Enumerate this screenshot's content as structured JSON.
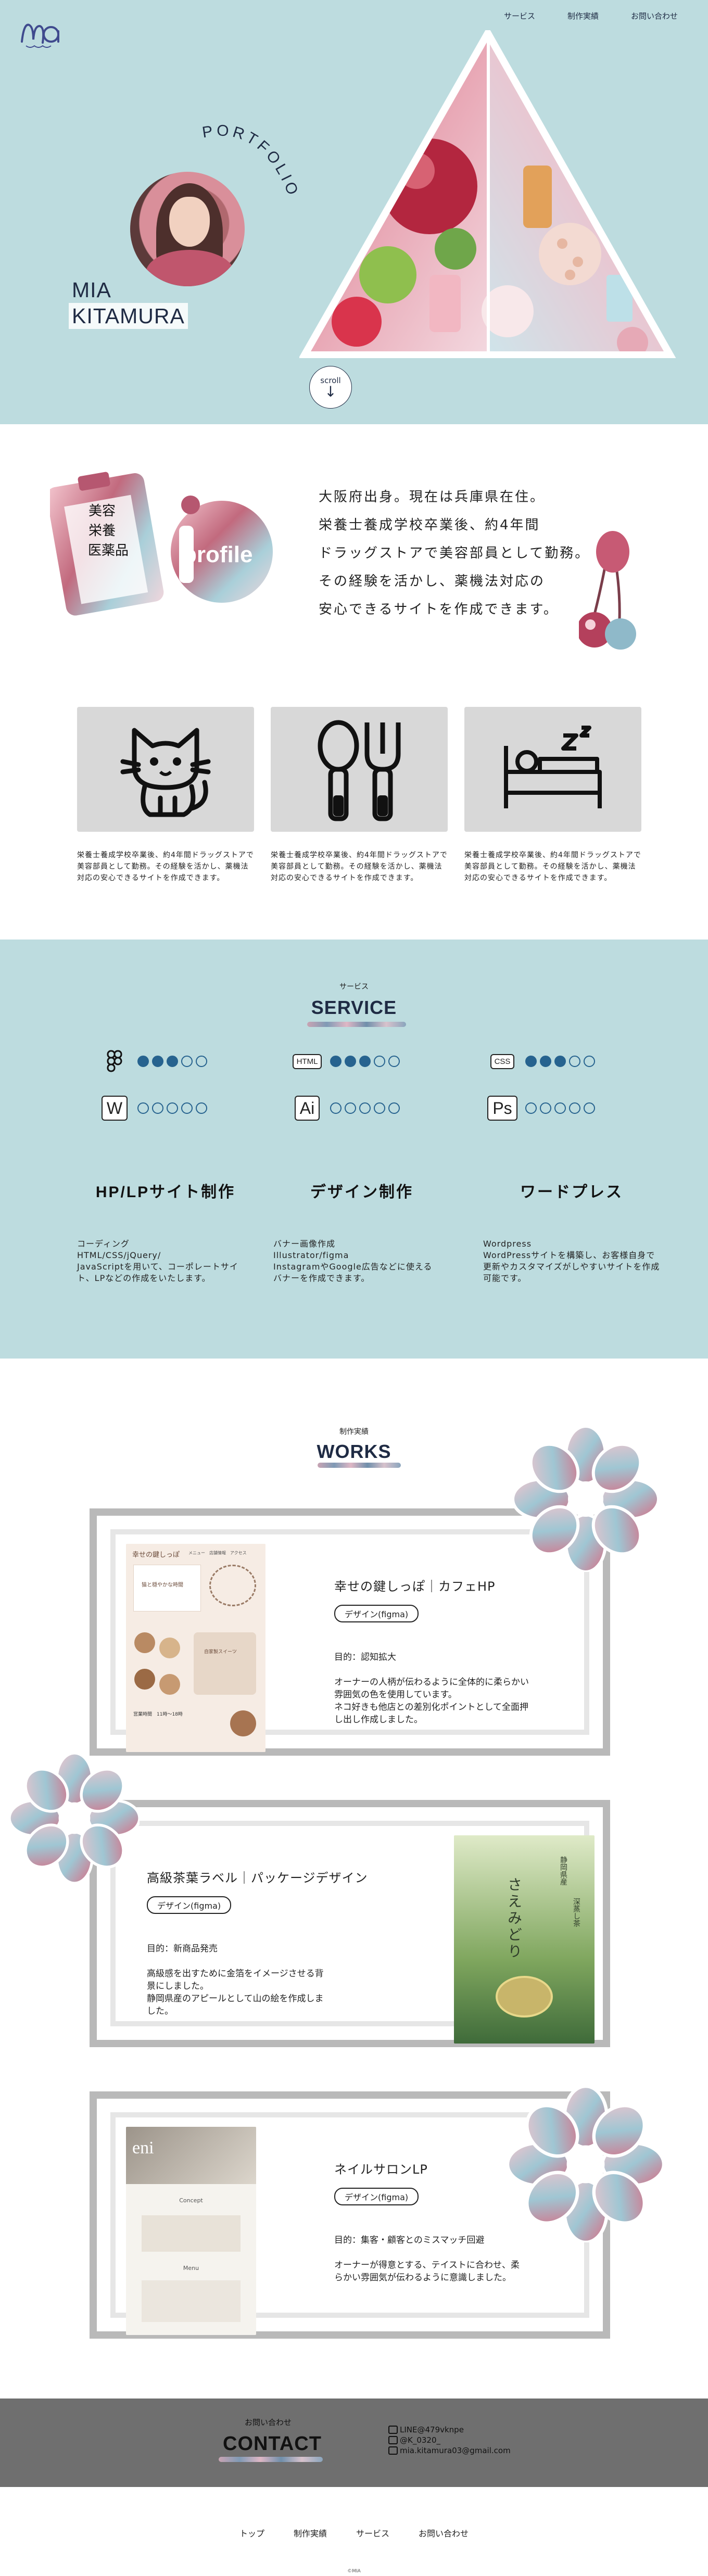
{
  "nav": {
    "items": [
      "サービス",
      "制作実績",
      "お問い合わせ"
    ]
  },
  "hero": {
    "portfolio_label": "PORTFOLIO",
    "name_line1": "MIA",
    "name_line2": "KITAMURA",
    "scroll_label": "scroll",
    "scroll_arrow": "↓"
  },
  "profile": {
    "art_words": [
      "美容",
      "栄養",
      "医薬品"
    ],
    "art_label": "profile",
    "text_lines": [
      "大阪府出身。現在は兵庫県在住。",
      "栄養士養成学校卒業後、約4年間",
      "ドラッグストアで美容部員として勤務。",
      "その経験を活かし、薬機法対応の",
      "安心できるサイトを作成できます。"
    ],
    "features": [
      {
        "icon": "cat-icon",
        "desc": "栄養士養成学校卒業後、約4年間ドラッグストアで美容部員として勤務。その経験を活かし、薬機法対応の安心できるサイトを作成できます。"
      },
      {
        "icon": "spoon-fork-icon",
        "desc": "栄養士養成学校卒業後、約4年間ドラッグストアで美容部員として勤務。その経験を活かし、薬機法対応の安心できるサイトを作成できます。"
      },
      {
        "icon": "sleep-icon",
        "desc": "栄養士養成学校卒業後、約4年間ドラッグストアで美容部員として勤務。その経験を活かし、薬機法対応の安心できるサイトを作成できます。"
      }
    ]
  },
  "service": {
    "subtitle": "サービス",
    "title": "SERVICE",
    "skills": [
      {
        "icon": "figma-icon",
        "label": "",
        "level": 3
      },
      {
        "icon": "html-icon",
        "label": "HTML",
        "level": 3
      },
      {
        "icon": "css-icon",
        "label": "CSS",
        "level": 3
      },
      {
        "icon": "word-icon",
        "label": "W",
        "level": 0
      },
      {
        "icon": "illustrator-icon",
        "label": "Ai",
        "level": 0
      },
      {
        "icon": "photoshop-icon",
        "label": "Ps",
        "level": 0
      }
    ],
    "columns": [
      {
        "title": "HP/LPサイト制作",
        "desc": "コーディング\nHTML/CSS/jQuery/\nJavaScriptを用いて、コーポレートサイト、LPなどの作成をいたします。"
      },
      {
        "title": "デザイン制作",
        "desc": "バナー画像作成\nIllustrator/figma\nInstagramやGoogle広告などに使える\nバナーを作成できます。"
      },
      {
        "title": "ワードプレス",
        "desc": "Wordpress\nWordPressサイトを構築し、お客様自身で更新やカスタマイズがしやすいサイトを作成可能です。"
      }
    ]
  },
  "works": {
    "subtitle": "制作実績",
    "title": "WORKS",
    "items": [
      {
        "title": "幸せの鍵しっぽ｜カフェHP",
        "tag": "デザイン(figma)",
        "goal": "目的：認知拡大",
        "desc": "オーナーの人柄が伝わるように全体的に柔らかい\n雰囲気の色を使用しています。\nネコ好きも他店との差別化ポイントとして全面押\nし出し作成しました。",
        "thumb_title": "幸せの鍵しっぽ",
        "thumb_nav": "メニュー　店舗情報　アクセス",
        "thumb_tagline": "猫と穏やかな時間",
        "thumb_menu": "自家製スイーツ",
        "thumb_info": "営業時間　11時～18時"
      },
      {
        "title": "高級茶葉ラベル｜パッケージデザイン",
        "tag": "デザイン(figma)",
        "goal": "目的：新商品発売",
        "desc": "高級感を出すために金箔をイメージさせる背\n景にしました。\n静岡県産のアピールとして山の絵を作成しま\nした。",
        "thumb_title": "さえみどり",
        "thumb_sub1": "静岡県産",
        "thumb_sub2": "深蒸し茶"
      },
      {
        "title": "ネイルサロンLP",
        "tag": "デザイン(figma)",
        "goal": "目的：集客・顧客とのミスマッチ回避",
        "desc": "オーナーが得意とする、テイストに合わせ、柔\nらかい雰囲気が伝わるように意識しました。",
        "thumb_title": "eni",
        "thumb_concept": "Concept",
        "thumb_menu": "Menu"
      }
    ]
  },
  "contact": {
    "subtitle": "お問い合わせ",
    "title": "CONTACT",
    "line": "LINE@479vknpe",
    "x": "@K_0320_",
    "mail": "mia.kitamura03@gmail.com"
  },
  "footer": {
    "items": [
      "トップ",
      "制作実績",
      "サービス",
      "お問い合わせ"
    ],
    "copyright": "©MIA"
  },
  "colors": {
    "hero_bg": "#bddcdf",
    "accent": "#27638f",
    "text": "#222222",
    "contact_bg": "#6f6f6f"
  }
}
